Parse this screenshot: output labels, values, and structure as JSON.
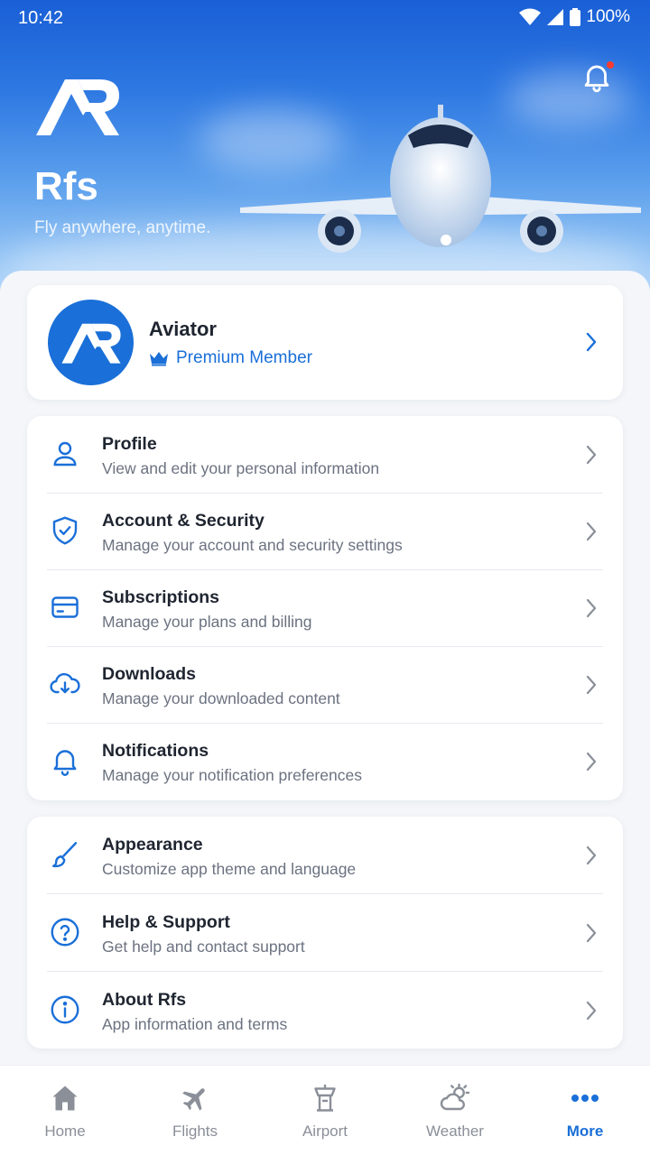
{
  "status_bar": {
    "time": "10:42",
    "battery": "100%"
  },
  "hero": {
    "title": "Rfs",
    "subtitle": "Fly anywhere, anytime."
  },
  "profile": {
    "name": "Aviator",
    "membership": "Premium Member"
  },
  "menu_group_1": [
    {
      "title": "Profile",
      "desc": "View and edit your personal information",
      "icon": "user-icon"
    },
    {
      "title": "Account & Security",
      "desc": "Manage your account and security settings",
      "icon": "shield-check-icon"
    },
    {
      "title": "Subscriptions",
      "desc": "Manage your plans and billing",
      "icon": "credit-card-icon"
    },
    {
      "title": "Downloads",
      "desc": "Manage your downloaded content",
      "icon": "cloud-download-icon"
    },
    {
      "title": "Notifications",
      "desc": "Manage your notification preferences",
      "icon": "bell-icon"
    }
  ],
  "menu_group_2": [
    {
      "title": "Appearance",
      "desc": "Customize app theme and language",
      "icon": "brush-icon"
    },
    {
      "title": "Help & Support",
      "desc": "Get help and contact support",
      "icon": "help-circle-icon"
    },
    {
      "title": "About Rfs",
      "desc": "App information and terms",
      "icon": "info-icon"
    }
  ],
  "bottom_nav": [
    {
      "label": "Home",
      "icon": "home-icon",
      "active": false
    },
    {
      "label": "Flights",
      "icon": "plane-icon",
      "active": false
    },
    {
      "label": "Airport",
      "icon": "control-tower-icon",
      "active": false
    },
    {
      "label": "Weather",
      "icon": "partly-cloudy-icon",
      "active": false
    },
    {
      "label": "More",
      "icon": "more-dots-icon",
      "active": true
    }
  ],
  "colors": {
    "accent": "#1a6fd8",
    "text": "#1f2530",
    "muted": "#6b7280",
    "badge": "#ff3b30"
  }
}
